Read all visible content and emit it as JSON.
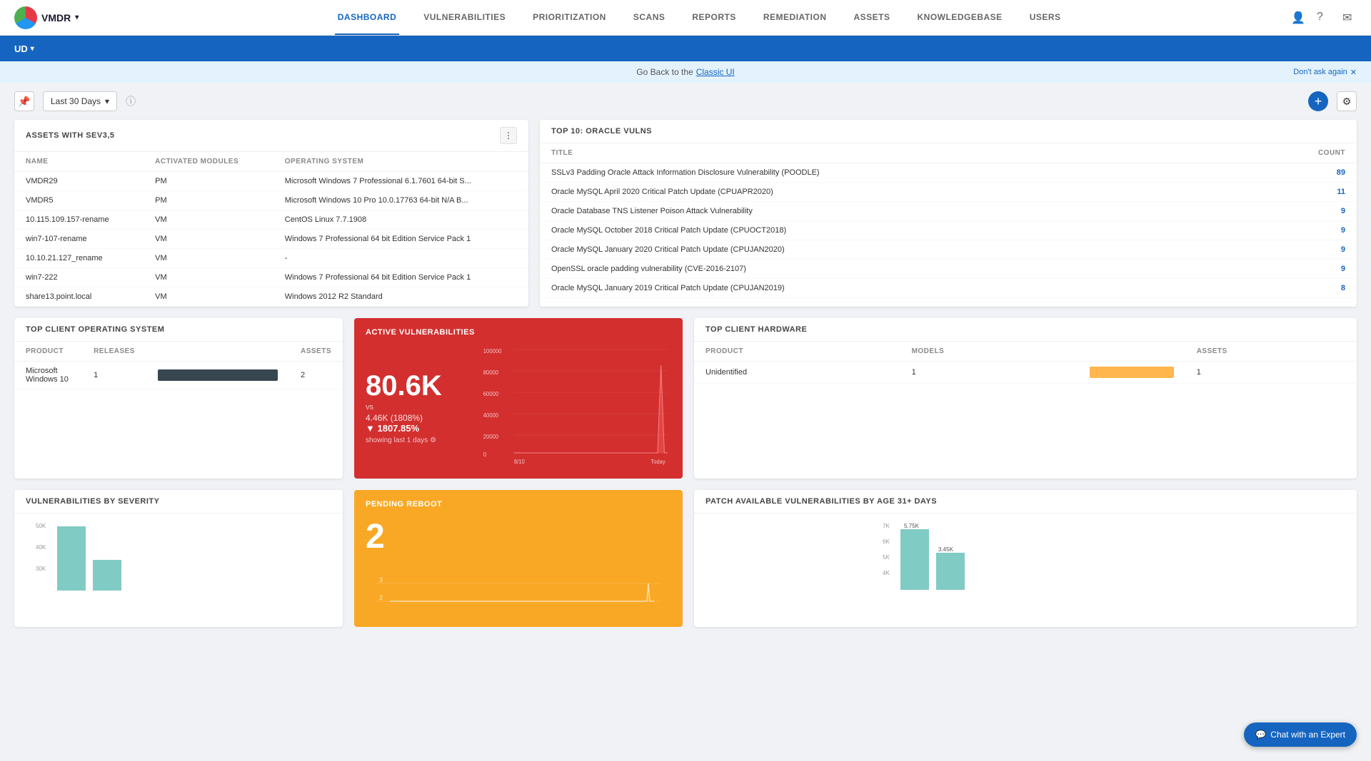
{
  "app": {
    "name": "VMDR",
    "logo_alt": "VMDR Logo"
  },
  "nav": {
    "links": [
      {
        "id": "dashboard",
        "label": "DASHBOARD",
        "active": true
      },
      {
        "id": "vulnerabilities",
        "label": "VULNERABILITIES",
        "active": false
      },
      {
        "id": "prioritization",
        "label": "PRIORITIZATION",
        "active": false
      },
      {
        "id": "scans",
        "label": "SCANS",
        "active": false
      },
      {
        "id": "reports",
        "label": "REPORTS",
        "active": false
      },
      {
        "id": "remediation",
        "label": "REMEDIATION",
        "active": false
      },
      {
        "id": "assets",
        "label": "ASSETS",
        "active": false
      },
      {
        "id": "knowledgebase",
        "label": "KNOWLEDGEBASE",
        "active": false
      },
      {
        "id": "users",
        "label": "USERS",
        "active": false
      }
    ]
  },
  "subnav": {
    "org_label": "UD"
  },
  "banner": {
    "text": "Go Back to the ",
    "link_text": "Classic UI",
    "dont_ask": "Don't ask again"
  },
  "toolbar": {
    "date_range": "Last 30 Days",
    "add_label": "+",
    "settings_label": "⚙"
  },
  "assets_widget": {
    "title": "ASSETS WITH SEV3,5",
    "columns": [
      "NAME",
      "ACTIVATED MODULES",
      "OPERATING SYSTEM"
    ],
    "rows": [
      {
        "name": "VMDR29",
        "modules": "PM",
        "os": "Microsoft Windows 7 Professional 6.1.7601 64-bit S..."
      },
      {
        "name": "VMDR5",
        "modules": "PM",
        "os": "Microsoft Windows 10 Pro 10.0.17763 64-bit N/A B..."
      },
      {
        "name": "10.115.109.157-rename",
        "modules": "VM",
        "os": "CentOS Linux 7.7.1908"
      },
      {
        "name": "win7-107-rename",
        "modules": "VM",
        "os": "Windows 7 Professional 64 bit Edition Service Pack 1"
      },
      {
        "name": "10.10.21.127_rename",
        "modules": "VM",
        "os": "-"
      },
      {
        "name": "win7-222",
        "modules": "VM",
        "os": "Windows 7 Professional 64 bit Edition Service Pack 1"
      },
      {
        "name": "share13.point.local",
        "modules": "VM",
        "os": "Windows 2012 R2 Standard"
      }
    ]
  },
  "oracle_widget": {
    "title": "TOP 10: ORACLE VULNS",
    "columns": [
      "TITLE",
      "COUNT"
    ],
    "rows": [
      {
        "title": "SSLv3 Padding Oracle Attack Information Disclosure Vulnerability (POODLE)",
        "count": "89"
      },
      {
        "title": "Oracle MySQL April 2020 Critical Patch Update (CPUAPR2020)",
        "count": "11"
      },
      {
        "title": "Oracle Database TNS Listener Poison Attack Vulnerability",
        "count": "9"
      },
      {
        "title": "Oracle MySQL October 2018 Critical Patch Update (CPUOCT2018)",
        "count": "9"
      },
      {
        "title": "Oracle MySQL January 2020 Critical Patch Update (CPUJAN2020)",
        "count": "9"
      },
      {
        "title": "OpenSSL oracle padding vulnerability (CVE-2016-2107)",
        "count": "9"
      },
      {
        "title": "Oracle MySQL January 2019 Critical Patch Update (CPUJAN2019)",
        "count": "8"
      }
    ]
  },
  "os_widget": {
    "title": "TOP CLIENT OPERATING SYSTEM",
    "columns": [
      "PRODUCT",
      "RELEASES",
      "ASSETS"
    ],
    "rows": [
      {
        "product": "Microsoft Windows 10",
        "releases": "1",
        "assets": "2",
        "bar_pct": 100
      }
    ]
  },
  "active_vuln": {
    "title": "ACTIVE VULNERABILITIES",
    "main_number": "80.6K",
    "vs_label": "vs",
    "sub_number": "4.46K (1808%)",
    "change": "▼ 1807.85%",
    "showing": "showing last 1 days ⚙",
    "y_labels": [
      "100000",
      "80000",
      "60000",
      "40000",
      "20000",
      "0"
    ],
    "x_start": "8/10",
    "x_end": "Today"
  },
  "hardware_widget": {
    "title": "TOP CLIENT HARDWARE",
    "columns": [
      "PRODUCT",
      "MODELS",
      "ASSETS"
    ],
    "rows": [
      {
        "product": "Unidentified",
        "models": "1",
        "assets": "1",
        "bar_pct": 100
      }
    ]
  },
  "severity_widget": {
    "title": "VULNERABILITIES BY SEVERITY",
    "y_labels": [
      "50K",
      "40K",
      "30K"
    ],
    "bars": [
      {
        "label": "",
        "value": 75,
        "color": "#80cbc4"
      },
      {
        "label": "",
        "value": 45,
        "color": "#80cbc4"
      }
    ]
  },
  "pending_reboot": {
    "title": "PENDING REBOOT",
    "big_number": "2",
    "chart_labels": [
      "3",
      "2"
    ],
    "x_start": "",
    "x_end": ""
  },
  "patch_age": {
    "title": "PATCH AVAILABLE VULNERABILITIES BY AGE 31+ DAYS",
    "y_labels": [
      "7K",
      "6K",
      "5K",
      "4K"
    ],
    "bar1_label": "5.75K",
    "bar2_label": "3.45K"
  }
}
